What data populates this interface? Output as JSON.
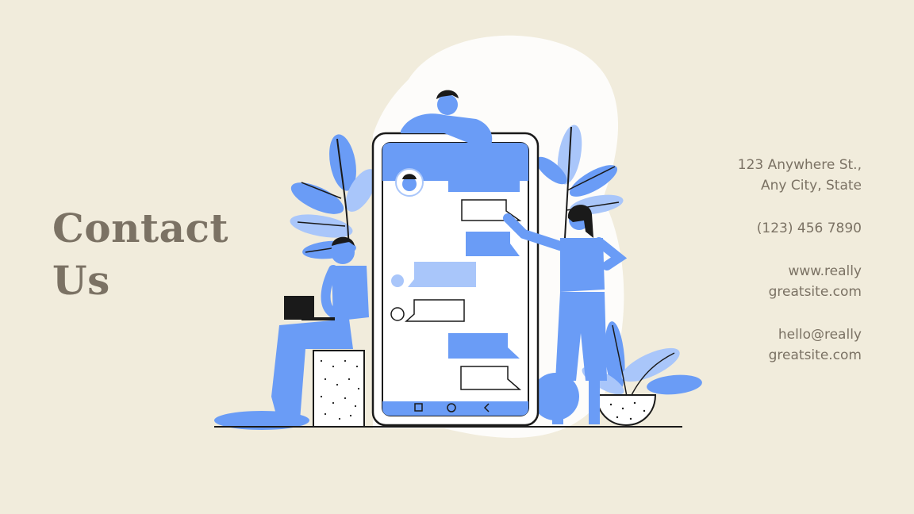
{
  "title": {
    "line1": "Contact",
    "line2": "Us"
  },
  "contact": {
    "address": [
      "123 Anywhere St.,",
      "Any City, State"
    ],
    "phone": "(123) 456 7890",
    "website": [
      "www.really",
      "greatsite.com"
    ],
    "email": [
      "hello@really",
      "greatsite.com"
    ]
  },
  "colors": {
    "background": "#f1ecdc",
    "text": "#7b7264",
    "accent_blue": "#6a9cf6",
    "light_blue": "#a9c6fa",
    "outline": "#1a1a1a"
  },
  "icons": {
    "nav_square": "square-icon",
    "nav_circle": "circle-icon",
    "nav_back": "chevron-left-icon"
  }
}
